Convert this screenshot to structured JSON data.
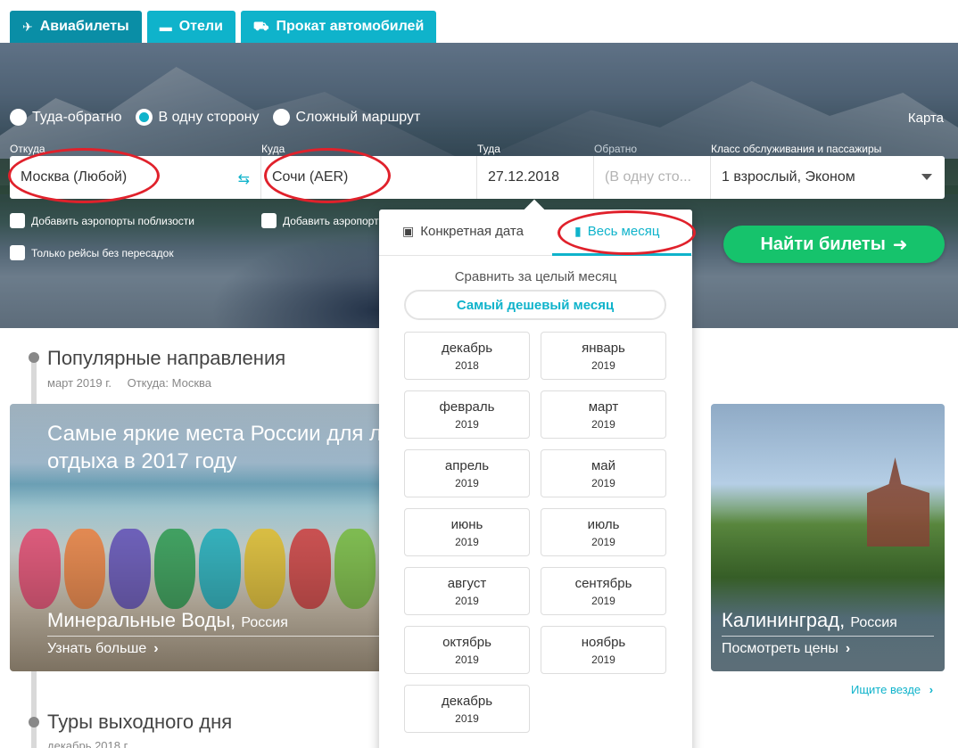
{
  "tabs": [
    {
      "label": "Авиабилеты",
      "icon": "plane-icon"
    },
    {
      "label": "Отели",
      "icon": "bed-icon"
    },
    {
      "label": "Прокат автомобилей",
      "icon": "car-icon"
    }
  ],
  "trip_type": {
    "options": [
      "Туда-обратно",
      "В одну сторону",
      "Сложный маршрут"
    ],
    "selected": "В одну сторону"
  },
  "map_link": "Карта",
  "form": {
    "from_label": "Откуда",
    "from_value": "Москва (Любой)",
    "to_label": "Куда",
    "to_value": "Сочи (AER)",
    "depart_label": "Туда",
    "depart_value": "27.12.2018",
    "return_label": "Обратно",
    "return_placeholder": "(В одну сто...",
    "class_label": "Класс обслуживания и пассажиры",
    "class_value": "1 взрослый, Эконом",
    "nearby_from": "Добавить аэропорты поблизости",
    "nearby_to": "Добавить аэропорт",
    "direct_only": "Только рейсы без пересадок",
    "search_button": "Найти билеты",
    "search_arrow": "➜"
  },
  "popover": {
    "tab_exact": "Конкретная дата",
    "tab_month": "Весь месяц",
    "compare_text": "Сравнить за целый месяц",
    "cheapest_button": "Самый дешевый месяц",
    "months": [
      {
        "m": "декабрь",
        "y": "2018"
      },
      {
        "m": "январь",
        "y": "2019"
      },
      {
        "m": "февраль",
        "y": "2019"
      },
      {
        "m": "март",
        "y": "2019"
      },
      {
        "m": "апрель",
        "y": "2019"
      },
      {
        "m": "май",
        "y": "2019"
      },
      {
        "m": "июнь",
        "y": "2019"
      },
      {
        "m": "июль",
        "y": "2019"
      },
      {
        "m": "август",
        "y": "2019"
      },
      {
        "m": "сентябрь",
        "y": "2019"
      },
      {
        "m": "октябрь",
        "y": "2019"
      },
      {
        "m": "ноябрь",
        "y": "2019"
      },
      {
        "m": "декабрь",
        "y": "2019"
      }
    ]
  },
  "popular": {
    "title": "Популярные направления",
    "subtitle": "март 2019 г.",
    "from": "Откуда: Москва",
    "card1_headline": "Самые яркие места России для л отдыха в 2017 году",
    "card1_city": "Минеральные Воды,",
    "card1_country": "Россия",
    "card1_link": "Узнать больше",
    "card2_city": "Калининград,",
    "card2_country": "Россия",
    "card2_link": "Посмотреть цены",
    "see_all": "Ищите везде"
  },
  "tours": {
    "title": "Туры выходного дня",
    "subtitle": "декабрь 2018 г."
  },
  "colors": {
    "accent": "#0fb3cb",
    "search_green": "#16c36c",
    "annotation_red": "#e0212b"
  }
}
